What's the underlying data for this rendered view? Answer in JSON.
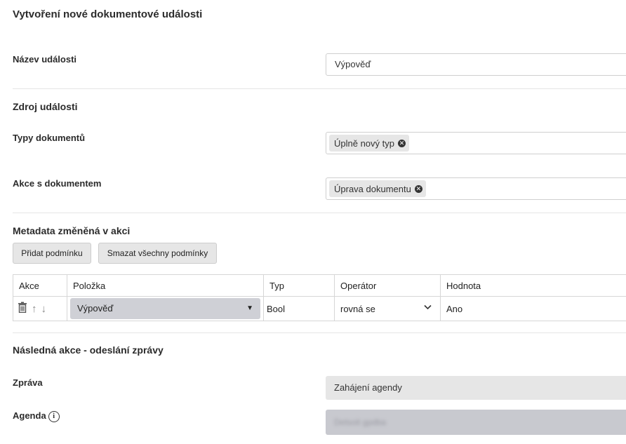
{
  "page": {
    "title": "Vytvoření nové dokumentové události"
  },
  "event_name": {
    "label": "Název události",
    "value": "Výpověď"
  },
  "source": {
    "section_title": "Zdroj události",
    "doc_types_label": "Typy dokumentů",
    "doc_types": [
      "Úplně nový typ"
    ],
    "doc_actions_label": "Akce s dokumentem",
    "doc_actions": [
      "Úprava dokumentu"
    ]
  },
  "metadata": {
    "section_title": "Metadata změněná v akci",
    "add_condition_label": "Přidat podmínku",
    "clear_conditions_label": "Smazat všechny podmínky",
    "columns": [
      "Akce",
      "Položka",
      "Typ",
      "Operátor",
      "Hodnota"
    ],
    "rows": [
      {
        "item": "Výpověď",
        "type": "Bool",
        "operator": "rovná se",
        "value": "Ano"
      }
    ]
  },
  "followup": {
    "section_title": "Následná akce - odeslání zprávy",
    "message_label": "Zpráva",
    "message_value": "Zahájení agendy",
    "agenda_label": "Agenda",
    "agenda_value": "Detsoit gpdba"
  },
  "icons": {
    "remove_tag": "close-circle-icon",
    "delete_row": "trash-icon",
    "move_up": "arrow-up-icon",
    "move_down": "arrow-down-icon",
    "dropdown": "caret-down-icon",
    "info": "info-icon"
  }
}
